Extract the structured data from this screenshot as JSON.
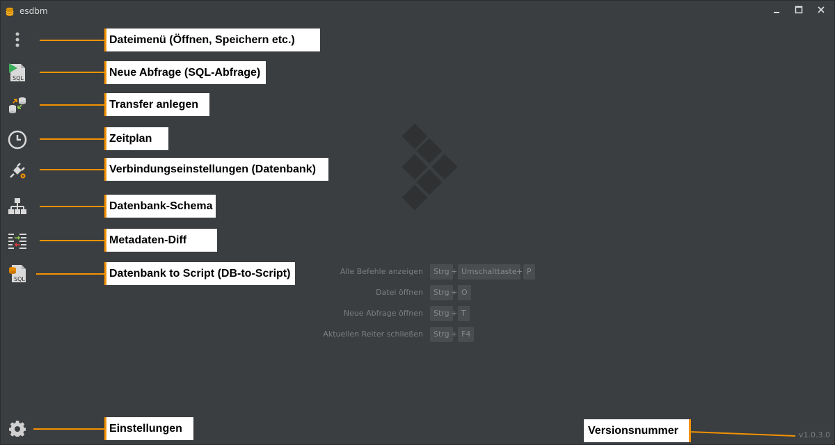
{
  "window": {
    "title": "esdbm"
  },
  "sidebar": {
    "items": [
      {
        "icon": "more-vertical-icon",
        "label": "Dateimenü (Öffnen, Speichern etc.)"
      },
      {
        "icon": "sql-query-icon",
        "label": "Neue Abfrage (SQL-Abfrage)"
      },
      {
        "icon": "transfer-icon",
        "label": "Transfer anlegen"
      },
      {
        "icon": "clock-icon",
        "label": "Zeitplan"
      },
      {
        "icon": "plug-settings-icon",
        "label": "Verbindungseinstellungen (Datenbank)"
      },
      {
        "icon": "hierarchy-icon",
        "label": "Datenbank-Schema"
      },
      {
        "icon": "diff-icon",
        "label": "Metadaten-Diff"
      },
      {
        "icon": "db-to-script-icon",
        "label": "Datenbank to Script (DB-to-Script)"
      }
    ],
    "settings": {
      "icon": "gear-icon",
      "label": "Einstellungen"
    }
  },
  "shortcuts": [
    {
      "label": "Alle Befehle anzeigen",
      "keys": [
        "Strg",
        "Umschalttaste",
        "P"
      ]
    },
    {
      "label": "Datei öffnen",
      "keys": [
        "Strg",
        "O"
      ]
    },
    {
      "label": "Neue Abfrage öffnen",
      "keys": [
        "Strg",
        "T"
      ]
    },
    {
      "label": "Aktuellen Reiter schließen",
      "keys": [
        "Strg",
        "F4"
      ]
    }
  ],
  "version": {
    "text": "v1.0.3.0",
    "callout": "Versionsnummer"
  },
  "colors": {
    "background": "#3b3e40",
    "accent": "#f39200",
    "logo": "#2f3132"
  }
}
